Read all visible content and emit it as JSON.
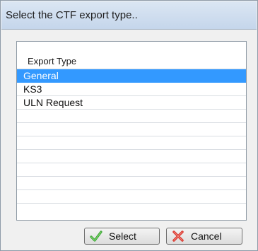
{
  "dialog": {
    "title": "Select the CTF export type.."
  },
  "list": {
    "header": "Export Type",
    "rows": [
      "General",
      "KS3",
      "ULN Request"
    ],
    "selected_index": 0,
    "empty_rows": 7
  },
  "buttons": {
    "select_label": "Select",
    "cancel_label": "Cancel"
  },
  "colors": {
    "selection": "#3399ff",
    "select_icon": "#3aa534",
    "cancel_icon": "#d9342b"
  },
  "icons": {
    "select": "checkmark-icon",
    "cancel": "cross-icon"
  }
}
